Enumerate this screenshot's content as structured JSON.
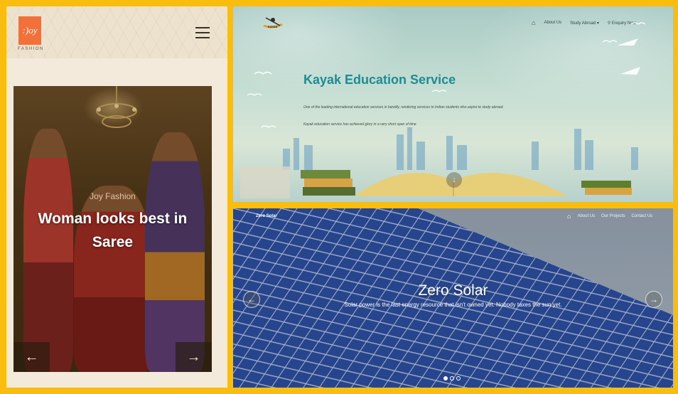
{
  "joy": {
    "logo_text": ":)oy",
    "logo_sub": "FASHION",
    "caption_small": "Joy Fashion",
    "caption_title": "Woman looks best in Saree",
    "prev_icon": "←",
    "next_icon": "→"
  },
  "kayak": {
    "logo_label": "KAYAK",
    "nav": [
      "About Us",
      "Study Abroad ▾",
      "Enquiry Now"
    ],
    "title": "Kayak Education Service",
    "text1": "One of the leading international education services in bareilly, rendering services to Indian students who aspire to study abroad.",
    "text2": "Kayak education service has achieved glory in a very short span of time",
    "down_icon": "↓"
  },
  "solar": {
    "brand": "Zero Solar",
    "nav": [
      "About Us",
      "Our Projects",
      "Contact Us"
    ],
    "title": "Zero Solar",
    "subtitle": "Solar power is the last energy resource that isn't owned yet. Nobody taxes the sun yet.",
    "prev_icon": "←",
    "next_icon": "→",
    "slides": 3,
    "active_slide": 1
  },
  "colors": {
    "frame": "#f9bd0f",
    "joy_logo": "#f2703a",
    "kayak_title": "#1f8b93"
  }
}
